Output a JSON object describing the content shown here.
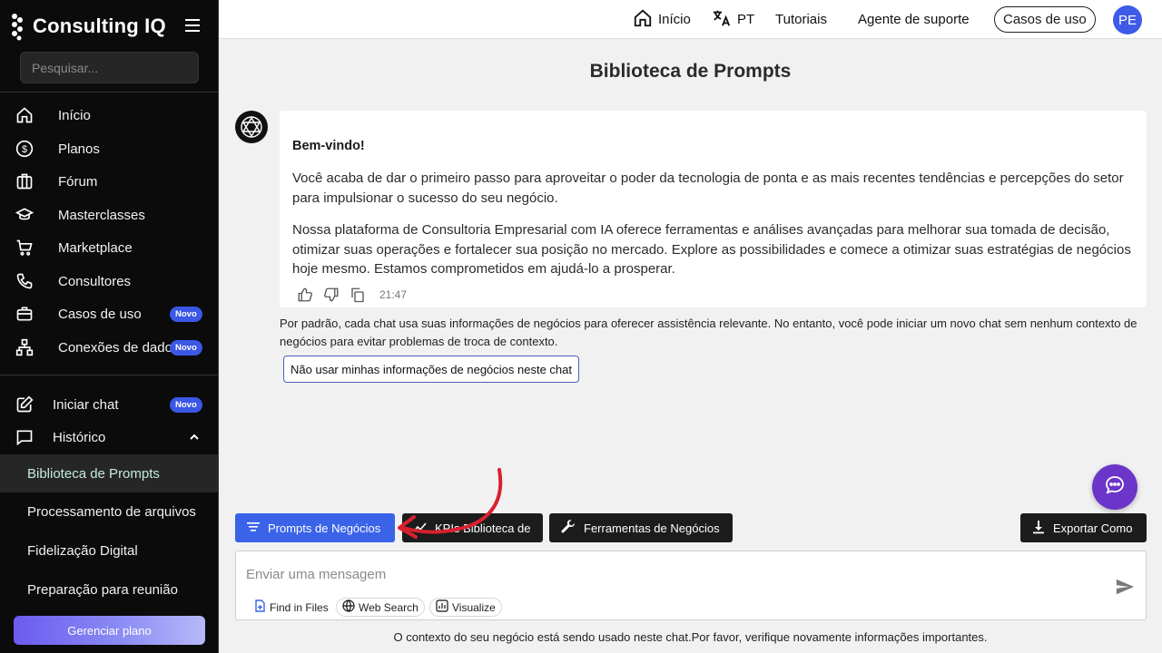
{
  "sidebar": {
    "brand": "Consulting IQ",
    "search_placeholder": "Pesquisar...",
    "nav": [
      {
        "label": "Início",
        "icon": "home-icon"
      },
      {
        "label": "Planos",
        "icon": "dollar-icon"
      },
      {
        "label": "Fórum",
        "icon": "building-icon"
      },
      {
        "label": "Masterclasses",
        "icon": "graduation-cap-icon"
      },
      {
        "label": "Marketplace",
        "icon": "cart-icon"
      },
      {
        "label": "Consultores",
        "icon": "phone-icon"
      },
      {
        "label": "Casos de uso",
        "icon": "briefcase-icon",
        "badge": "Novo"
      },
      {
        "label": "Conexões de dados",
        "icon": "network-icon",
        "badge": "Novo"
      }
    ],
    "start_chat": {
      "label": "Iniciar chat",
      "badge": "Novo"
    },
    "history": {
      "label": "Histórico"
    },
    "history_items": [
      "Biblioteca de Prompts",
      "Processamento de arquivos",
      "Fidelização Digital",
      "Preparação para reunião"
    ],
    "manage_plan": "Gerenciar plano"
  },
  "topbar": {
    "home": "Início",
    "language": "PT",
    "tutorials": "Tutoriais",
    "support": "Agente de suporte",
    "use_cases": "Casos de uso",
    "avatar": "PE"
  },
  "main": {
    "title": "Biblioteca de Prompts",
    "message": {
      "greeting": "Bem-vindo!",
      "p1": "Você acaba de dar o primeiro passo para aproveitar o poder da tecnologia de ponta e as mais recentes tendências e percepções do setor para impulsionar o sucesso do seu negócio.",
      "p2": "Nossa plataforma de Consultoria Empresarial com IA oferece ferramentas e análises avançadas para melhorar sua tomada de decisão, otimizar suas operações e fortalecer sua posição no mercado. Explore as possibilidades e comece a otimizar suas estratégias de negócios hoje mesmo. Estamos comprometidos em ajudá-lo a prosperar.",
      "time": "21:47"
    },
    "context_note": "Por padrão, cada chat usa suas informações de negócios para oferecer assistência relevante. No entanto, você pode iniciar um novo chat sem nenhum contexto de negócios para evitar problemas de troca de contexto.",
    "context_button": "Não usar minhas informações de negócios neste chat",
    "toolbar": {
      "prompts": "Prompts de Negócios",
      "kpis": "KPIs Biblioteca de",
      "tools": "Ferramentas de Negócios",
      "export": "Exportar Como"
    },
    "composer": {
      "placeholder": "Enviar uma mensagem",
      "chips": [
        "Find in Files",
        "Web Search",
        "Visualize"
      ]
    },
    "footer": "O contexto do seu negócio está sendo usado neste chat.Por favor, verifique novamente informações importantes."
  },
  "colors": {
    "accent": "#3a63e8",
    "badge": "#3b57e6",
    "fab": "#6c35c9",
    "annotation": "#d9202e"
  }
}
